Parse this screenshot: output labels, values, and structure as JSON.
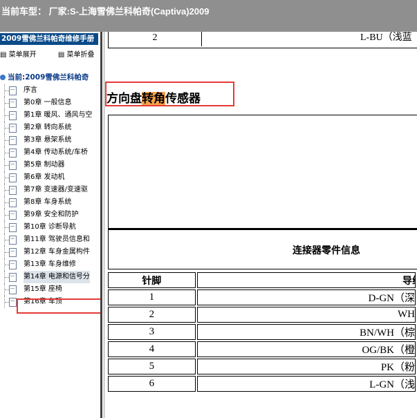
{
  "window": {
    "title": "当前车型： 厂家:S-上海雪佛兰科帕奇(Captiva)2009"
  },
  "sidebar": {
    "header": "2009雪佛兰科帕奇维修手册",
    "expand_label": "菜单展开",
    "collapse_label": "菜单折叠",
    "root_label": "当前:2009雪佛兰科帕奇",
    "items": [
      {
        "label": "序言"
      },
      {
        "label": "第0章 一般信息"
      },
      {
        "label": "第1章 暖风、通风与空"
      },
      {
        "label": "第2章 转向系统"
      },
      {
        "label": "第3章 悬架系统"
      },
      {
        "label": "第4章 传动系统/车桥"
      },
      {
        "label": "第5章 制动器"
      },
      {
        "label": "第6章 发动机"
      },
      {
        "label": "第7章 变速器/变速驱"
      },
      {
        "label": "第8章 车身系统"
      },
      {
        "label": "第9章 安全和防护"
      },
      {
        "label": "第10章 诊断导航"
      },
      {
        "label": "第11章 驾驶员信息和"
      },
      {
        "label": "第12章 车身金属构件"
      },
      {
        "label": "第13章 车身维修"
      },
      {
        "label": "第14章 电源和信号分"
      },
      {
        "label": "第15章 座椅"
      },
      {
        "label": "第16章 车顶"
      }
    ]
  },
  "main": {
    "top_row": {
      "pin": "2",
      "wire": "L-BU（浅蓝"
    },
    "section_title_pre": "方向盘",
    "section_title_highlight": "转角",
    "section_title_post": "传感器",
    "connector_title": "连接器零件信息",
    "table": {
      "headers": {
        "pin": "针脚",
        "wire": "导线"
      },
      "rows": [
        {
          "pin": "1",
          "wire": "D-GN（深"
        },
        {
          "pin": "2",
          "wire": "WH"
        },
        {
          "pin": "3",
          "wire": "BN/WH（棕"
        },
        {
          "pin": "4",
          "wire": "OG/BK（橙"
        },
        {
          "pin": "5",
          "wire": "PK（粉"
        },
        {
          "pin": "6",
          "wire": "L-GN（浅"
        }
      ]
    }
  }
}
